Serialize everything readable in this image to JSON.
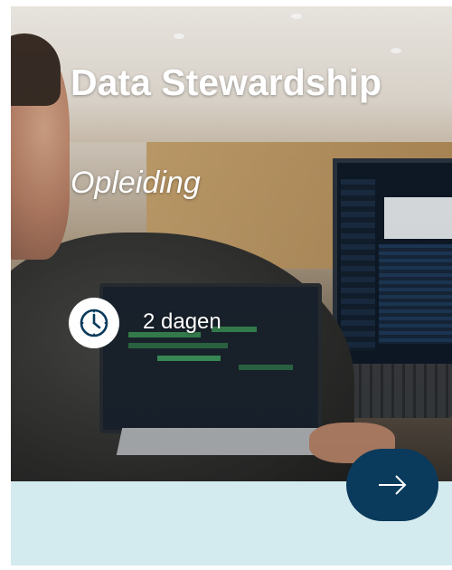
{
  "card": {
    "title": "Data Stewardship",
    "subtitle": "Opleiding",
    "duration": "2 dagen",
    "duration_icon": "clock-icon",
    "action_icon": "arrow-right-icon"
  },
  "colors": {
    "accent_button": "#0a3a5c",
    "card_background": "#d3eaee",
    "text_on_image": "#ffffff"
  }
}
